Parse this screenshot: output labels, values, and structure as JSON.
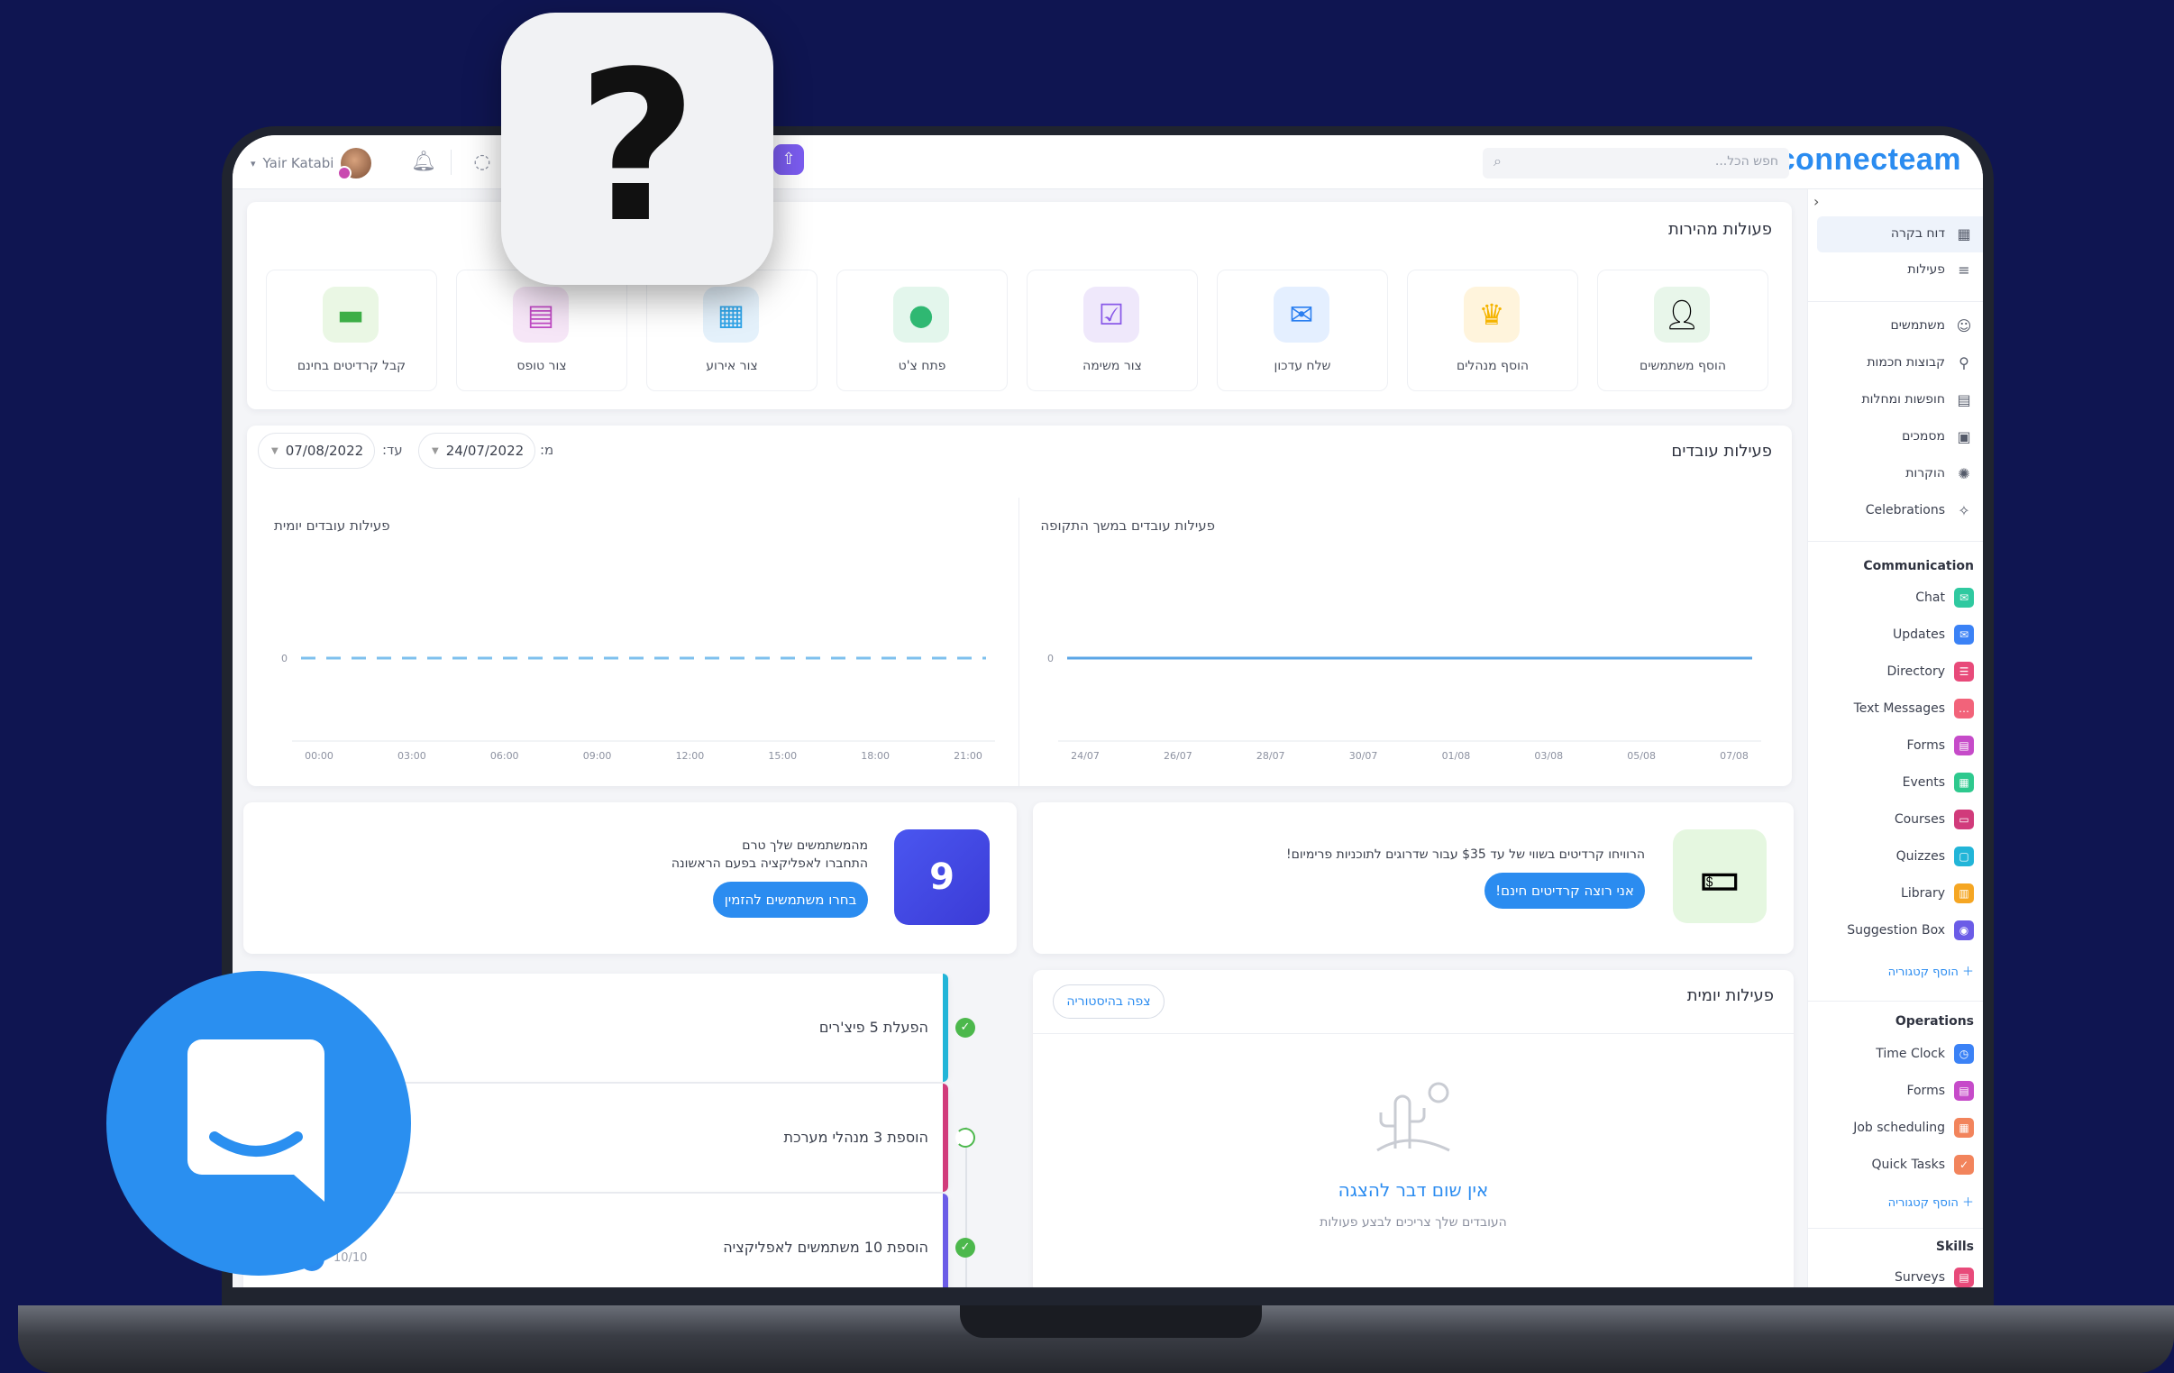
{
  "topbar": {
    "brand": "connecteam",
    "search_placeholder": "חפש הכל...",
    "user_name": "Yair Katabi"
  },
  "sidebar": {
    "main_items": [
      {
        "label": "דוח בקרה",
        "icon": "grid-icon"
      },
      {
        "label": "פעילות",
        "icon": "list-icon"
      },
      {
        "label": "משתמשים",
        "icon": "user-icon"
      },
      {
        "label": "קבוצות חכמות",
        "icon": "users-search-icon"
      },
      {
        "label": "חופשות ומחלות",
        "icon": "calendar-icon"
      },
      {
        "label": "מסמכים",
        "icon": "document-icon"
      },
      {
        "label": "הוקרות",
        "icon": "sun-icon"
      },
      {
        "label": "Celebrations",
        "icon": "party-icon"
      }
    ],
    "communication_header": "Communication",
    "communication_items": [
      {
        "label": "Chat",
        "color": "#2fc9a0"
      },
      {
        "label": "Updates",
        "color": "#3b82f6"
      },
      {
        "label": "Directory",
        "color": "#e84a7a"
      },
      {
        "label": "Text Messages",
        "color": "#f2637a"
      },
      {
        "label": "Forms",
        "color": "#c64bc9"
      },
      {
        "label": "Events",
        "color": "#2ec98e"
      },
      {
        "label": "Courses",
        "color": "#d13b7b"
      },
      {
        "label": "Quizzes",
        "color": "#22b5d8"
      },
      {
        "label": "Library",
        "color": "#f5a623"
      },
      {
        "label": "Suggestion Box",
        "color": "#6b5ce7"
      }
    ],
    "add_category": "הוסף קטגוריה",
    "operations_header": "Operations",
    "operations_items": [
      {
        "label": "Time Clock",
        "color": "#3b82f6"
      },
      {
        "label": "Forms",
        "color": "#c64bc9"
      },
      {
        "label": "Job scheduling",
        "color": "#f2845c"
      },
      {
        "label": "Quick Tasks",
        "color": "#f2845c"
      }
    ],
    "skills_header": "Skills",
    "skills_items": [
      {
        "label": "Surveys",
        "color": "#e84a7a"
      }
    ]
  },
  "quick_actions": {
    "title": "פעולות מהירות",
    "items": [
      {
        "label": "הוסף משתמשים",
        "icon": "person-icon",
        "bg": "#e8f6ea"
      },
      {
        "label": "הוסף מנהלים",
        "icon": "crown-icon",
        "bg": "#fff4dc"
      },
      {
        "label": "שלח עדכון",
        "icon": "envelope-icon",
        "bg": "#e4efff"
      },
      {
        "label": "צור משימה",
        "icon": "checkbox-icon",
        "bg": "#efe8fb"
      },
      {
        "label": "פתח צ'ט",
        "icon": "chat-icon",
        "bg": "#e3f6ec"
      },
      {
        "label": "צור אירוע",
        "icon": "calendar-icon",
        "bg": "#e4f1fb"
      },
      {
        "label": "צור טופס",
        "icon": "form-icon",
        "bg": "#f6e6f7"
      },
      {
        "label": "קבל קרדיטים בחינם",
        "icon": "money-icon",
        "bg": "#eaf7e4"
      }
    ]
  },
  "activity": {
    "title": "פעילות עובדים",
    "from_label": "מ:",
    "from_date": "24/07/2022",
    "to_label": "עד:",
    "to_date": "07/08/2022"
  },
  "chart_data": [
    {
      "type": "line",
      "title": "פעילות עובדים במשך התקופה",
      "x": [
        "24/07",
        "26/07",
        "28/07",
        "30/07",
        "01/08",
        "03/08",
        "05/08",
        "07/08"
      ],
      "series": [
        {
          "values": [
            0,
            0,
            0,
            0,
            0,
            0,
            0,
            0
          ],
          "color": "#5aa5e6"
        }
      ],
      "y_ticks": [
        "0"
      ],
      "grid": false
    },
    {
      "type": "line",
      "title": "פעילות עובדים יומית",
      "x": [
        "00:00",
        "03:00",
        "06:00",
        "09:00",
        "12:00",
        "15:00",
        "18:00",
        "21:00"
      ],
      "series": [
        {
          "values": [
            0,
            0,
            0,
            0,
            0,
            0,
            0,
            0
          ],
          "color": "#7ec0ee",
          "dashed": true
        }
      ],
      "y_ticks": [
        "0"
      ],
      "grid": false
    }
  ],
  "promos": {
    "credits_text": "הרוויחו קרדיטים בשווי של עד $35 עבור שדרוגים לתוכניות פרימיום!",
    "credits_button": "אני רוצה קרדיטים חינם!",
    "users_count": "9",
    "users_text_line1": "מהמשתמשים שלך טרם",
    "users_text_line2": "התחברו לאפליקציה בפעם הראשונה",
    "users_button": "בחרו משתמשים להזמין"
  },
  "daily": {
    "title": "פעילות יומית",
    "history_button": "צפה בהיסטוריה",
    "empty_title": "אין שום דבר להצגה",
    "empty_subtitle": "העובדים שלך צריכים לבצע פעולות"
  },
  "timeline": {
    "items": [
      {
        "label": "הפעלת 5 פיצ'רים",
        "color": "#22b5d8",
        "done": true
      },
      {
        "label": "הוספת 3 מנהלי מערכת",
        "color": "#d13b7b",
        "done": false
      },
      {
        "label": "הוספת 10 משתמשים לאפליקציה",
        "color": "#6b5ce7",
        "done": true
      }
    ],
    "pager": "10/10"
  }
}
